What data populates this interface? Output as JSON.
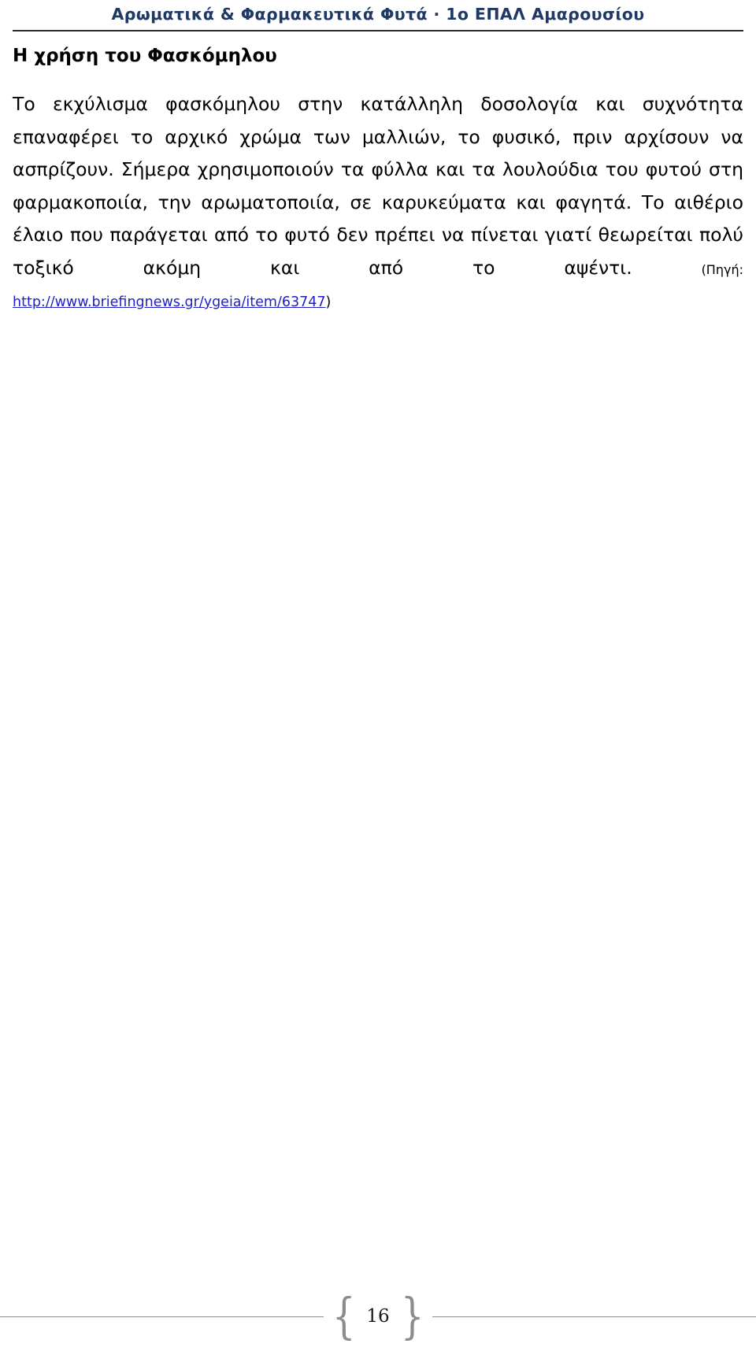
{
  "header": {
    "running_title": "Αρωματικά & Φαρμακευτικά Φυτά · 1ο ΕΠΑΛ Αμαρουσίου",
    "accent_color": "#1F3864",
    "rule_color": "#2b2b2b"
  },
  "content": {
    "section_title": "Η χρήση του Φασκόμηλου",
    "paragraph": "Το εκχύλισμα φασκόμηλου στην κατάλληλη δοσολογία και συχνότητα επαναφέρει το αρχικό χρώμα των μαλλιών, το φυσικό, πριν αρχίσουν να ασπρίζουν. Σήμερα χρησιμοποιούν τα φύλλα και τα λουλούδια του φυτού στη φαρμακοποιία, την αρωματοποιία, σε καρυκεύματα και φαγητά. Το αιθέριο έλαιο που παράγεται από το φυτό δεν πρέπει να πίνεται γιατί θεωρείται πολύ τοξικό ακόμη και από το αψέντι.",
    "source_label": "(Πηγή:",
    "source_url": "http://www.briefingnews.gr/ygeia/item/63747",
    "source_close": ")",
    "link_color": "#2020C8"
  },
  "footer": {
    "page_number": "16",
    "brace_open": "{",
    "brace_close": "}",
    "rule_color": "#8c8c8c"
  }
}
